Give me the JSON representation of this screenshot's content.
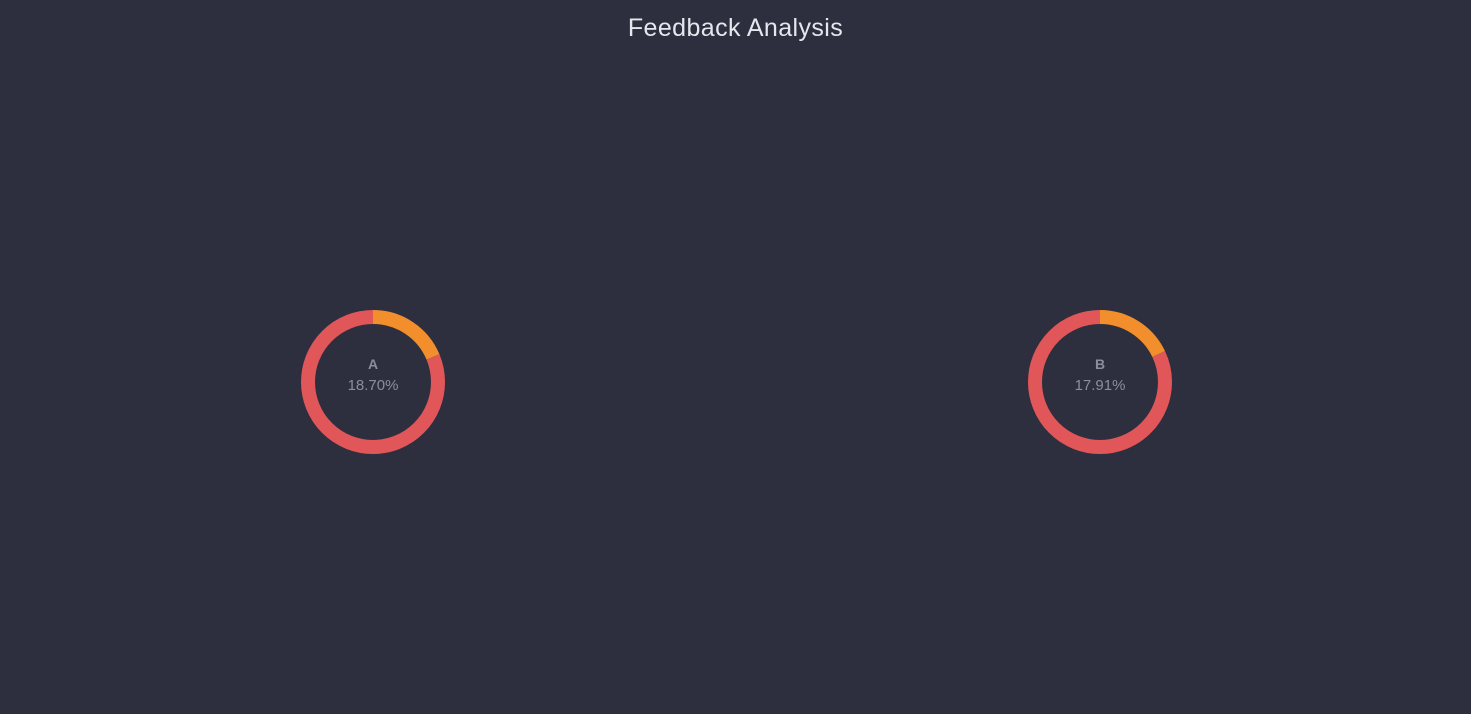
{
  "page": {
    "title": "Feedback Analysis"
  },
  "colors": {
    "background": "#2e2f3e",
    "share": "#f28e2b",
    "remainder": "#e15759"
  },
  "chart_data": [
    {
      "type": "pie",
      "label": "A",
      "value_label": "18.70%",
      "slices": [
        {
          "value": 18.7,
          "color": "#f28e2b"
        },
        {
          "value": 81.3,
          "color": "#e15759"
        }
      ]
    },
    {
      "type": "pie",
      "label": "B",
      "value_label": "17.91%",
      "slices": [
        {
          "value": 17.91,
          "color": "#f28e2b"
        },
        {
          "value": 82.09,
          "color": "#e15759"
        }
      ]
    }
  ]
}
